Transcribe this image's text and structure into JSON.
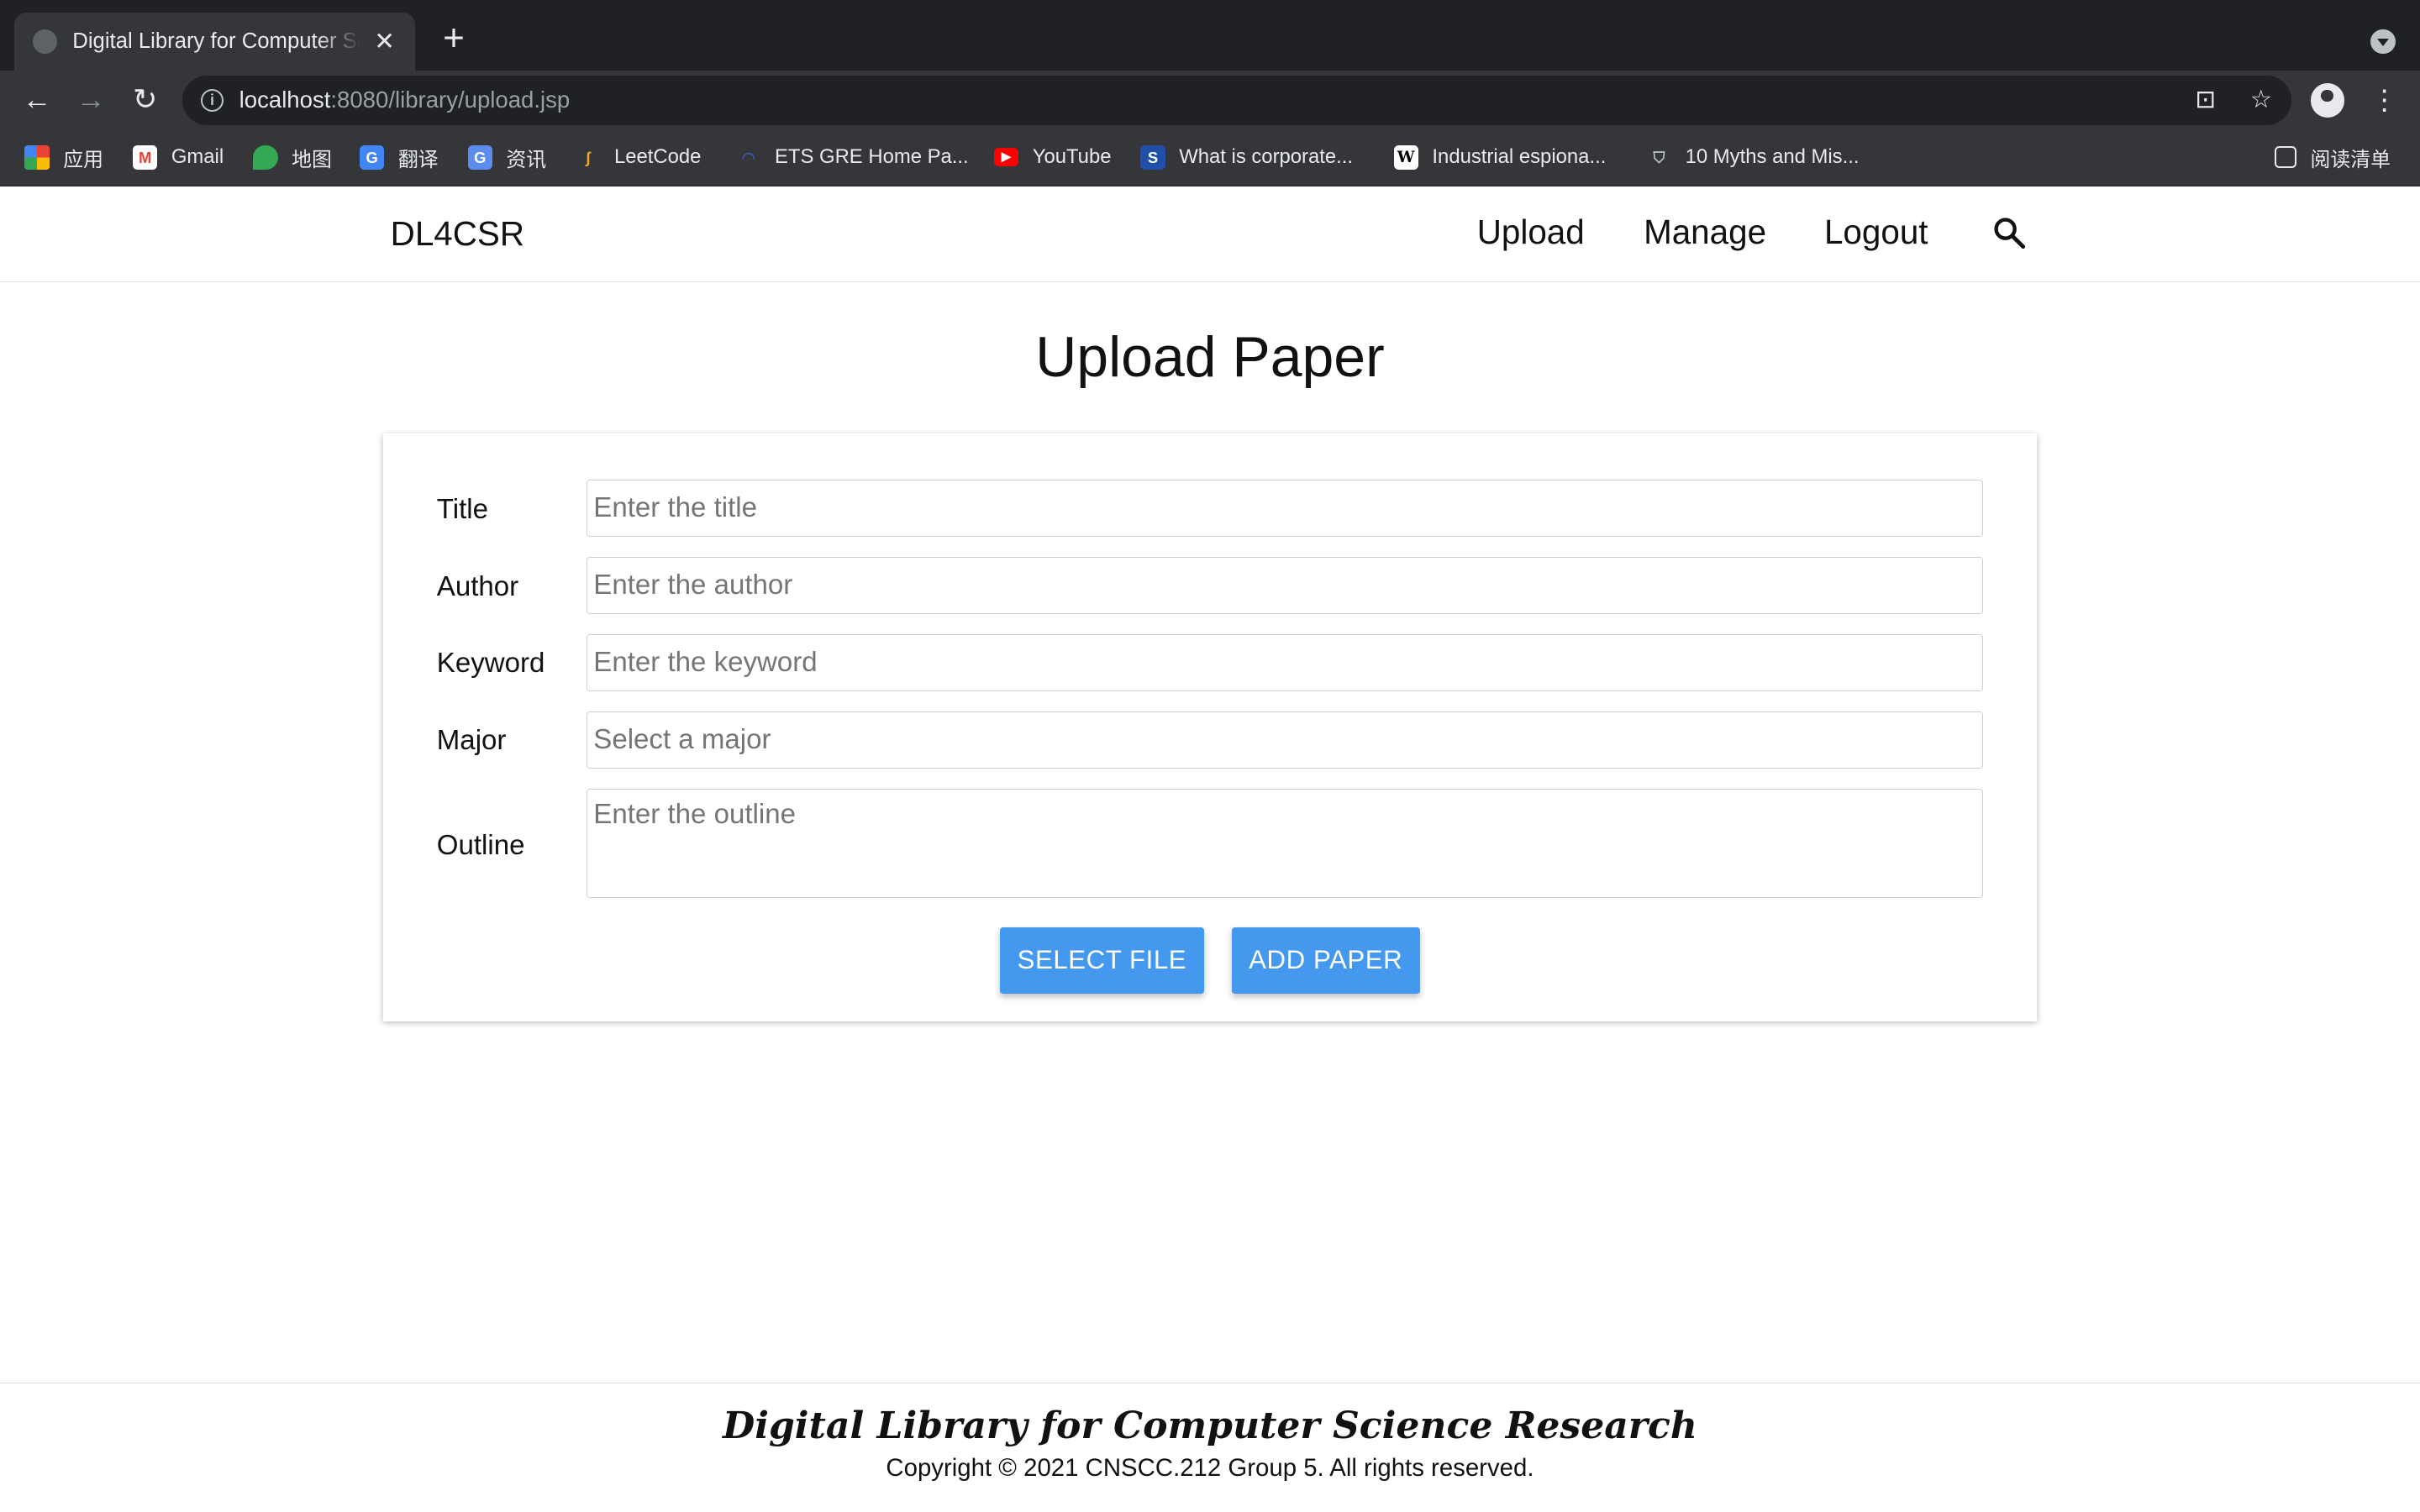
{
  "browser": {
    "tab_title": "Digital Library for Computer Science Research",
    "tab_close": "✕",
    "new_tab": "+",
    "url_host": "localhost",
    "url_path": ":8080/library/upload.jsp",
    "bookmarks": [
      {
        "label": "应用",
        "icon": "apps-grid-icon"
      },
      {
        "label": "Gmail",
        "icon": "gmail-icon"
      },
      {
        "label": "地图",
        "icon": "maps-icon"
      },
      {
        "label": "翻译",
        "icon": "translate-icon"
      },
      {
        "label": "资讯",
        "icon": "news-icon"
      },
      {
        "label": "LeetCode",
        "icon": "leetcode-icon"
      },
      {
        "label": "ETS GRE Home Pa...",
        "icon": "ets-icon"
      },
      {
        "label": "YouTube",
        "icon": "youtube-icon"
      },
      {
        "label": "What is corporate...",
        "icon": "s-icon"
      },
      {
        "label": "Industrial espiona...",
        "icon": "wikipedia-icon"
      },
      {
        "label": "10 Myths and Mis...",
        "icon": "shield-icon"
      }
    ],
    "reading_list": "阅读清单"
  },
  "header": {
    "brand": "DL4CSR",
    "nav": [
      "Upload",
      "Manage",
      "Logout"
    ]
  },
  "page": {
    "title": "Upload Paper"
  },
  "form": {
    "fields": [
      {
        "label": "Title",
        "placeholder": "Enter the title"
      },
      {
        "label": "Author",
        "placeholder": "Enter the author"
      },
      {
        "label": "Keyword",
        "placeholder": "Enter the keyword"
      },
      {
        "label": "Major",
        "placeholder": "Select a major"
      },
      {
        "label": "Outline",
        "placeholder": "Enter the outline"
      }
    ],
    "select_file_label": "SELECT FILE",
    "add_paper_label": "ADD PAPER",
    "button_color": "#4499ee"
  },
  "footer": {
    "title": "Digital Library for Computer Science Research",
    "copyright": "Copyright © 2021 CNSCC.212 Group 5. All rights reserved."
  }
}
